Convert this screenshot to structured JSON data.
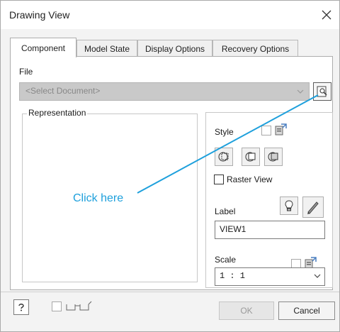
{
  "window": {
    "title": "Drawing View"
  },
  "tabs": [
    {
      "label": "Component",
      "active": true
    },
    {
      "label": "Model State",
      "active": false
    },
    {
      "label": "Display Options",
      "active": false
    },
    {
      "label": "Recovery Options",
      "active": false
    }
  ],
  "file": {
    "label": "File",
    "placeholder": "<Select Document>"
  },
  "representation": {
    "label": "Representation"
  },
  "style": {
    "label": "Style",
    "buttons": [
      "hidden-line-icon",
      "hidden-line-removed-icon",
      "shaded-icon"
    ],
    "raster_view_label": "Raster View"
  },
  "view_label": {
    "label": "Label",
    "value": "VIEW1"
  },
  "scale": {
    "label": "Scale",
    "value": "1 : 1"
  },
  "footer": {
    "ok_label": "OK",
    "cancel_label": "Cancel"
  },
  "annotation": {
    "text": "Click here",
    "color": "#1ea0dc"
  }
}
